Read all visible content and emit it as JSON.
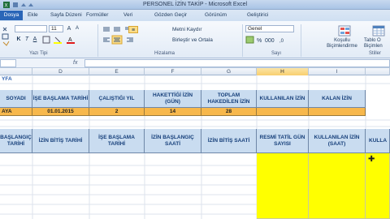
{
  "window": {
    "title": "PERSONEL İZİN TAKİP  -  Microsoft Excel"
  },
  "tabs": [
    {
      "label": "Dosya"
    },
    {
      "label": "Ekle"
    },
    {
      "label": "Sayfa Düzeni"
    },
    {
      "label": "Formüller"
    },
    {
      "label": "Veri"
    },
    {
      "label": "Gözden Geçir"
    },
    {
      "label": "Görünüm"
    },
    {
      "label": "Geliştirici"
    }
  ],
  "ribbon": {
    "font_size": "11",
    "wrap_text_label": "Metni Kaydır",
    "merge_center_label": "Birleştir ve Ortala",
    "number_format": "Genel",
    "conditional_format_label": "Koşullu Biçimlendirme",
    "table_format_label": "Tablo O Biçimlen",
    "groups": {
      "font": "Yazı Tipi",
      "alignment": "Hizalama",
      "number": "Sayı",
      "styles": "Stiller"
    }
  },
  "columns": [
    "",
    "D",
    "E",
    "F",
    "G",
    "H",
    "I"
  ],
  "selected_column": "H",
  "sheet": {
    "link_text": "YFA",
    "table1": {
      "headers": [
        "SOYADI",
        "İŞE BAŞLAMA TARİHİ",
        "ÇALIŞTIĞI YIL",
        "HAKETTİĞİ İZİN (GÜN)",
        "TOPLAM HAKEDİLEN İZİN",
        "KULLANILAN İZİN",
        "KALAN İZİN"
      ],
      "row": [
        "AYA",
        "01.01.2015",
        "2",
        "14",
        "28",
        "",
        ""
      ]
    },
    "table2": {
      "headers": [
        "BAŞLANGIÇ TARİHİ",
        "İZİN BİTİŞ TARİHİ",
        "İŞE BAŞLAMA TARİHİ",
        "İZİN BAŞLANGIÇ SAATİ",
        "İZİN BİTİŞ SAATİ",
        "RESMİ TATİL GÜN SAYISI",
        "KULLANILAN İZİN (SAAT)",
        "KULLA"
      ]
    }
  }
}
